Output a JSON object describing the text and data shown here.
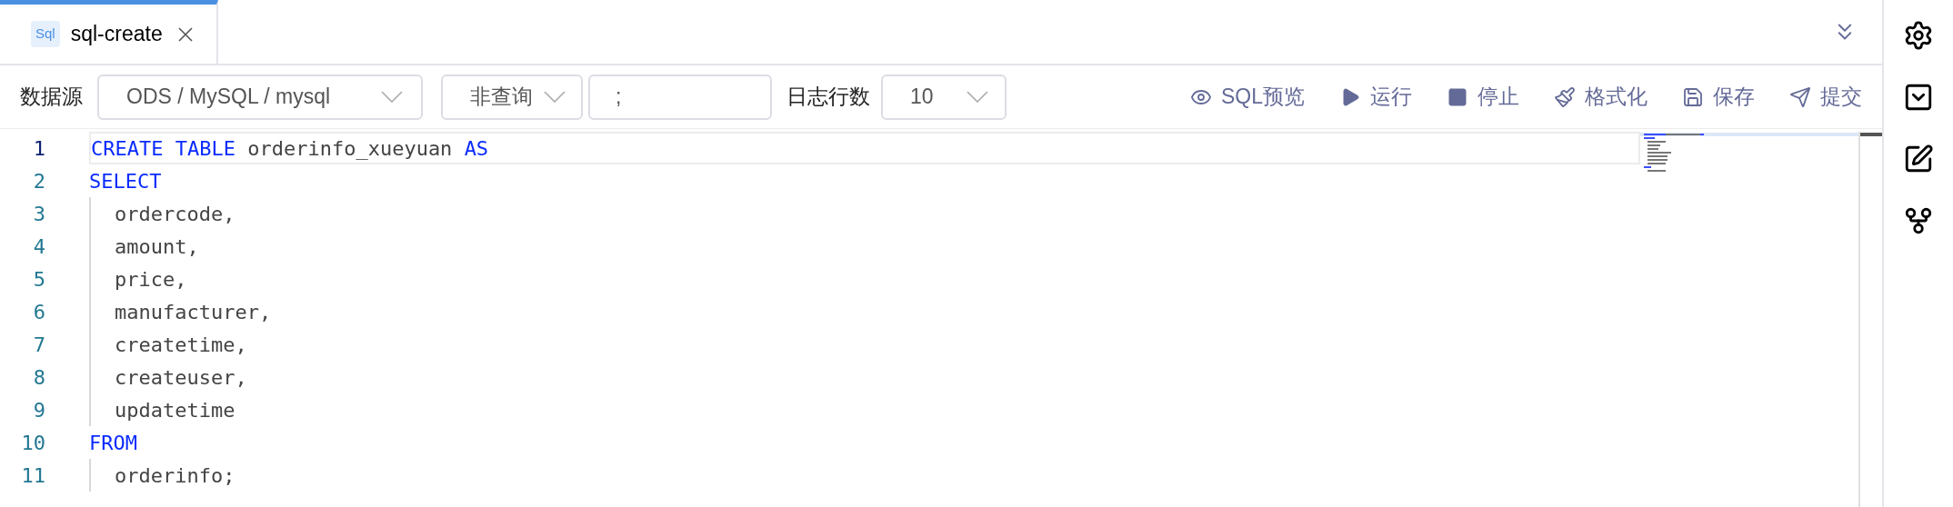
{
  "tabs": [
    {
      "icon_text": "Sql",
      "label": "sql-create",
      "selected": true
    }
  ],
  "toolbar": {
    "datasource_label": "数据源",
    "datasource": {
      "value": "ODS / MySQL / mysql"
    },
    "query_type": {
      "value": "非查询"
    },
    "delimiter": {
      "value": ";"
    },
    "log_rows_label": "日志行数",
    "log_rows": {
      "value": "10"
    },
    "actions": [
      {
        "kind": "preview",
        "label": "SQL预览"
      },
      {
        "kind": "run",
        "label": "运行"
      },
      {
        "kind": "stop",
        "label": "停止"
      },
      {
        "kind": "format",
        "label": "格式化"
      },
      {
        "kind": "save",
        "label": "保存"
      },
      {
        "kind": "submit",
        "label": "提交"
      }
    ]
  },
  "editor": {
    "lines": [
      {
        "number": "1",
        "current": true,
        "indented": false,
        "tokens": [
          {
            "kind": "keyword",
            "text": "CREATE TABLE"
          },
          {
            "kind": "plain",
            "text": " orderinfo_xueyuan "
          },
          {
            "kind": "keyword",
            "text": "AS"
          }
        ]
      },
      {
        "number": "2",
        "current": false,
        "indented": false,
        "tokens": [
          {
            "kind": "keyword",
            "text": "SELECT"
          }
        ]
      },
      {
        "number": "3",
        "current": false,
        "indented": true,
        "tokens": [
          {
            "kind": "plain",
            "text": "ordercode,"
          }
        ]
      },
      {
        "number": "4",
        "current": false,
        "indented": true,
        "tokens": [
          {
            "kind": "plain",
            "text": "amount,"
          }
        ]
      },
      {
        "number": "5",
        "current": false,
        "indented": true,
        "tokens": [
          {
            "kind": "plain",
            "text": "price,"
          }
        ]
      },
      {
        "number": "6",
        "current": false,
        "indented": true,
        "tokens": [
          {
            "kind": "plain",
            "text": "manufacturer,"
          }
        ]
      },
      {
        "number": "7",
        "current": false,
        "indented": true,
        "tokens": [
          {
            "kind": "plain",
            "text": "createtime,"
          }
        ]
      },
      {
        "number": "8",
        "current": false,
        "indented": true,
        "tokens": [
          {
            "kind": "plain",
            "text": "createuser,"
          }
        ]
      },
      {
        "number": "9",
        "current": false,
        "indented": true,
        "tokens": [
          {
            "kind": "plain",
            "text": "updatetime"
          }
        ]
      },
      {
        "number": "10",
        "current": false,
        "indented": false,
        "tokens": [
          {
            "kind": "keyword",
            "text": "FROM"
          }
        ]
      },
      {
        "number": "11",
        "current": false,
        "indented": true,
        "tokens": [
          {
            "kind": "plain",
            "text": "orderinfo;"
          }
        ]
      }
    ]
  }
}
